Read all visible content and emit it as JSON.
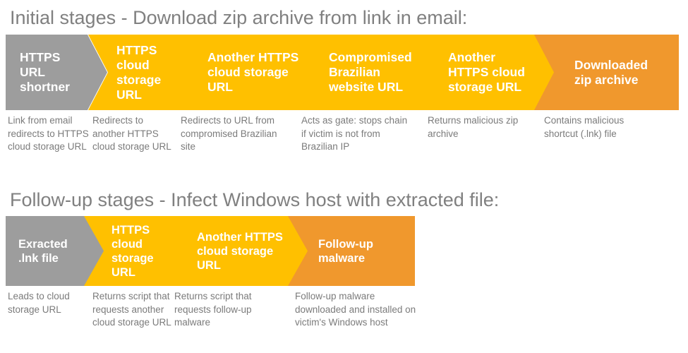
{
  "colors": {
    "gray": "#9d9d9d",
    "yellow": "#ffc000",
    "orange": "#f0982d",
    "title_text": "#808080",
    "caption_text": "#7b7b7b",
    "chevron_text": "#ffffff",
    "background": "#ffffff"
  },
  "sections": [
    {
      "id": "initial",
      "title": "Initial stages - Download zip archive from link in email:",
      "stages": [
        {
          "label": "HTTPS URL shortner",
          "caption": "Link from email redirects to HTTPS cloud storage URL",
          "color": "gray",
          "shape": "chevron-start"
        },
        {
          "label": "HTTPS cloud storage URL",
          "caption": "Redirects to another HTTPS cloud storage URL",
          "color": "yellow",
          "shape": "chevron"
        },
        {
          "label": "Another HTTPS cloud storage URL",
          "caption": "Redirects to URL from compromised Brazilian site",
          "color": "yellow",
          "shape": "chevron"
        },
        {
          "label": "Compromised Brazilian website URL",
          "caption": "Acts as gate: stops chain if victim is not from Brazilian IP",
          "color": "yellow",
          "shape": "chevron"
        },
        {
          "label": "Another HTTPS cloud storage URL",
          "caption": "Returns malicious zip archive",
          "color": "yellow",
          "shape": "chevron"
        },
        {
          "label": "Downloaded zip archive",
          "caption": "Contains malicious shortcut (.lnk) file",
          "color": "orange",
          "shape": "chevron-end"
        }
      ]
    },
    {
      "id": "followup",
      "title": "Follow-up stages - Infect Windows host with extracted file:",
      "stages": [
        {
          "label": "Exracted .lnk file",
          "caption": "Leads to cloud storage URL",
          "color": "gray",
          "shape": "chevron-start"
        },
        {
          "label": "HTTPS cloud storage URL",
          "caption": "Returns script that requests another cloud storage URL",
          "color": "yellow",
          "shape": "chevron"
        },
        {
          "label": "Another HTTPS cloud storage URL",
          "caption": "Returns script that requests follow-up malware",
          "color": "yellow",
          "shape": "chevron"
        },
        {
          "label": "Follow-up malware",
          "caption": "Follow-up malware downloaded and installed on victim's Windows host",
          "color": "orange",
          "shape": "chevron-end"
        }
      ]
    }
  ]
}
